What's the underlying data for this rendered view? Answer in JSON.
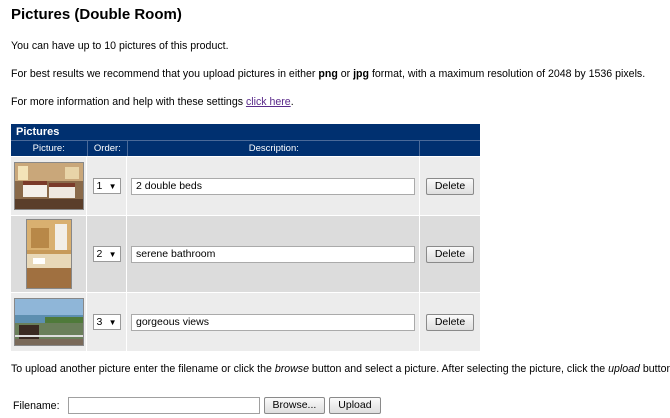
{
  "page": {
    "title": "Pictures (Double Room)",
    "limit_text": "You can have up to 10 pictures of this product.",
    "format_pre": "For best results we recommend that you upload pictures in either ",
    "format_png": "png",
    "format_or": " or ",
    "format_jpg": "jpg",
    "format_post": " format, with a maximum resolution of 2048 by 1536 pixels.",
    "help_pre": "For more information and help with these settings ",
    "help_link": "click here",
    "help_post": "."
  },
  "table": {
    "heading": "Pictures",
    "columns": [
      "Picture:",
      "Order:",
      "Description:",
      ""
    ],
    "rows": [
      {
        "order": "1",
        "description": "2 double beds",
        "image": "hotel-room-double-beds",
        "delete_label": "Delete"
      },
      {
        "order": "2",
        "description": "serene bathroom",
        "image": "hotel-bathroom",
        "delete_label": "Delete"
      },
      {
        "order": "3",
        "description": "gorgeous views",
        "image": "balcony-sea-view",
        "delete_label": "Delete"
      }
    ]
  },
  "upload": {
    "instr_pre": "To upload another picture enter the filename or click the ",
    "instr_browse": "browse",
    "instr_mid": " button and select a picture. After selecting the picture, click the ",
    "instr_upload": "upload",
    "instr_post": " button.",
    "filename_label": "Filename:",
    "filename_value": "",
    "browse_label": "Browse...",
    "upload_label": "Upload"
  },
  "colors": {
    "header_bg": "#003070",
    "row_light": "#ececec",
    "row_dark": "#dcdcdc",
    "link": "#5a2a8a"
  },
  "icons": {
    "dropdown": "chevron-down-icon"
  }
}
